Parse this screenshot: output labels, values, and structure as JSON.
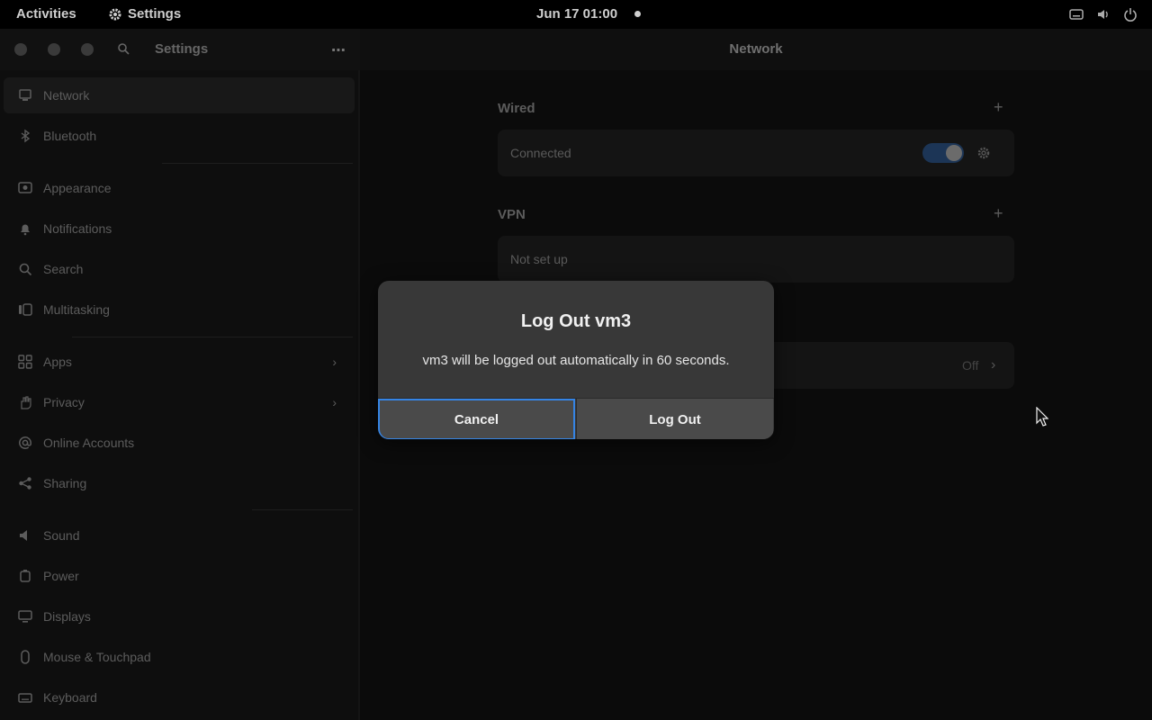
{
  "topbar": {
    "activities": "Activities",
    "app_name": "Settings",
    "clock": "Jun 17  01:00"
  },
  "sidebar_header": {
    "title": "Settings"
  },
  "main_header": {
    "title": "Network"
  },
  "sidebar": {
    "items": [
      {
        "label": "Network",
        "icon": "network-icon"
      },
      {
        "label": "Bluetooth",
        "icon": "bluetooth-icon"
      },
      {
        "label": "Appearance",
        "icon": "appearance-icon"
      },
      {
        "label": "Notifications",
        "icon": "bell-icon"
      },
      {
        "label": "Search",
        "icon": "search-icon"
      },
      {
        "label": "Multitasking",
        "icon": "multitasking-icon"
      },
      {
        "label": "Apps",
        "icon": "apps-grid-icon"
      },
      {
        "label": "Privacy",
        "icon": "hand-icon"
      },
      {
        "label": "Online Accounts",
        "icon": "at-icon"
      },
      {
        "label": "Sharing",
        "icon": "share-icon"
      },
      {
        "label": "Sound",
        "icon": "speaker-icon"
      },
      {
        "label": "Power",
        "icon": "power-icon"
      },
      {
        "label": "Displays",
        "icon": "display-icon"
      },
      {
        "label": "Mouse & Touchpad",
        "icon": "mouse-icon"
      },
      {
        "label": "Keyboard",
        "icon": "keyboard-icon"
      }
    ]
  },
  "network": {
    "wired_title": "Wired",
    "wired_status": "Connected",
    "vpn_title": "VPN",
    "vpn_status": "Not set up",
    "proxy_value": "Off"
  },
  "dialog": {
    "heading": "Log Out vm3",
    "body": "vm3 will be logged out automatically in 60 seconds.",
    "cancel_label": "Cancel",
    "logout_label": "Log Out"
  },
  "colors": {
    "accent": "#3584e4",
    "dialog_bg": "#383838"
  }
}
